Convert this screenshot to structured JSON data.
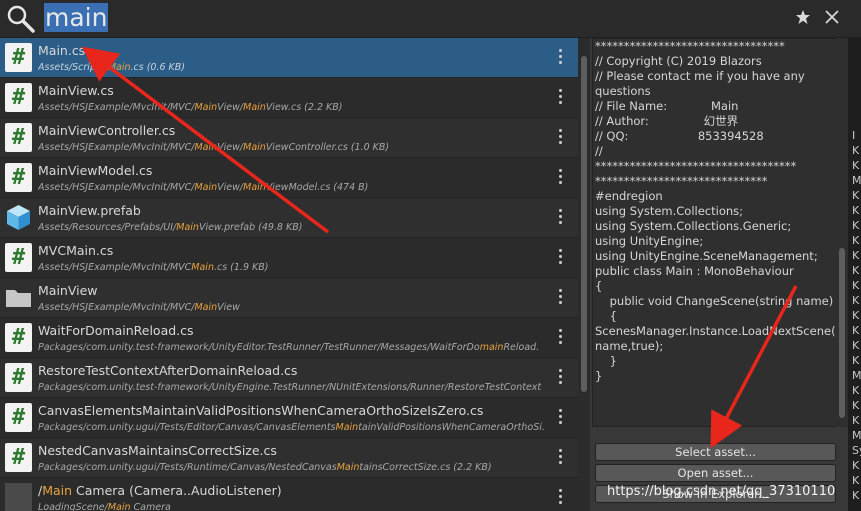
{
  "search": {
    "query": "main"
  },
  "results": [
    {
      "title": "Main.cs",
      "path_pre": "Assets/Scripts/",
      "path_hl": "Main",
      "path_post": ".cs (0.6 KB)",
      "icon": "csharp-script-icon",
      "selected": true
    },
    {
      "title": "MainView.cs",
      "path_pre": "Assets/HSJExample/MvcInit/MVC/",
      "path_hl": "Main",
      "path_post": "View/",
      "path_hl2": "Main",
      "path_post2": "View.cs (2.2 KB)",
      "icon": "csharp-script-icon"
    },
    {
      "title": "MainViewController.cs",
      "path_pre": "Assets/HSJExample/MvcInit/MVC/",
      "path_hl": "Main",
      "path_post": "View/",
      "path_hl2": "Main",
      "path_post2": "ViewController.cs (1.0 KB)",
      "icon": "csharp-script-icon"
    },
    {
      "title": "MainViewModel.cs",
      "path_pre": "Assets/HSJExample/MvcInit/MVC/",
      "path_hl": "Main",
      "path_post": "View/",
      "path_hl2": "Main",
      "path_post2": "ViewModel.cs (474 B)",
      "icon": "csharp-script-icon"
    },
    {
      "title": "MainView.prefab",
      "path_pre": "Assets/Resources/Prefabs/UI/",
      "path_hl": "Main",
      "path_post": "View.prefab (49.8 KB)",
      "icon": "prefab-cube-icon"
    },
    {
      "title": "MVCMain.cs",
      "path_pre": "Assets/HSJExample/MvcInit/MVC",
      "path_hl": "Main",
      "path_post": ".cs (1.9 KB)",
      "icon": "csharp-script-icon"
    },
    {
      "title": "MainView",
      "path_pre": "Assets/HSJExample/MvcInit/MVC/",
      "path_hl": "Main",
      "path_post": "View",
      "icon": "folder-icon"
    },
    {
      "title": "WaitForDomainReload.cs",
      "path_pre": "Packages/com.unity.test-framework/UnityEditor.TestRunner/TestRunner/Messages/WaitForDo",
      "path_hl": "main",
      "path_post": "Reload.",
      "icon": "csharp-script-icon"
    },
    {
      "title": "RestoreTestContextAfterDomainReload.cs",
      "path_pre": "Packages/com.unity.test-framework/UnityEngine.TestRunner/NUnitExtensions/Runner/RestoreTestContext",
      "path_hl": "",
      "path_post": "",
      "icon": "csharp-script-icon"
    },
    {
      "title": "CanvasElementsMaintainValidPositionsWhenCameraOrthoSizeIsZero.cs",
      "path_pre": "Packages/com.unity.ugui/Tests/Editor/Canvas/CanvasElements",
      "path_hl": "Main",
      "path_post": "tainValidPositionsWhenCameraOrthoSi.",
      "icon": "csharp-script-icon"
    },
    {
      "title": "NestedCanvasMaintainsCorrectSize.cs",
      "path_pre": "Packages/com.unity.ugui/Tests/Runtime/Canvas/NestedCanvas",
      "path_hl": "Main",
      "path_post": "tainsCorrectSize.cs (2.2 KB)",
      "icon": "csharp-script-icon"
    },
    {
      "title_pre": "/",
      "title_hl": "Main",
      "title_post": " Camera (Camera..AudioListener)",
      "path_pre": "LoadingScene/",
      "path_hl": "Main",
      "path_post": " Camera",
      "icon": "gameobject-icon"
    }
  ],
  "preview": {
    "code": [
      "*********************************",
      "// Copyright (C) 2019 Blazors",
      "// Please contact me if you have any",
      "questions",
      "// File Name:            Main",
      "// Author:               幻世界",
      "// QQ:                   853394528",
      "//",
      "***********************************",
      "******************************",
      "#endregion",
      "using System.Collections;",
      "using System.Collections.Generic;",
      "using UnityEngine;",
      "using UnityEngine.SceneManagement;",
      "",
      "public class Main : MonoBehaviour",
      "{",
      "    public void ChangeScene(string name)",
      "    {",
      "",
      "ScenesManager.Instance.LoadNextScene(",
      "name,true);",
      "    }",
      "}"
    ],
    "buttons": [
      "Select asset...",
      "Open asset...",
      "Show in Explorer..."
    ]
  },
  "console_edge": [
    "",
    "",
    "",
    "",
    "",
    "",
    "I",
    "K",
    "K",
    "M",
    "K",
    "K",
    "K",
    "K",
    "K",
    "K",
    "K",
    "K",
    "K",
    "K",
    "K",
    "K",
    "M",
    "K",
    "K",
    "K",
    "M",
    "Sy",
    "K",
    "K",
    "K"
  ],
  "watermark": "https://blog.csdn.net/qq_37310110",
  "colors": {
    "selected_row": "#2c5d87",
    "highlight": "#e8a33d",
    "annotation_arrow": "#e8261c"
  }
}
